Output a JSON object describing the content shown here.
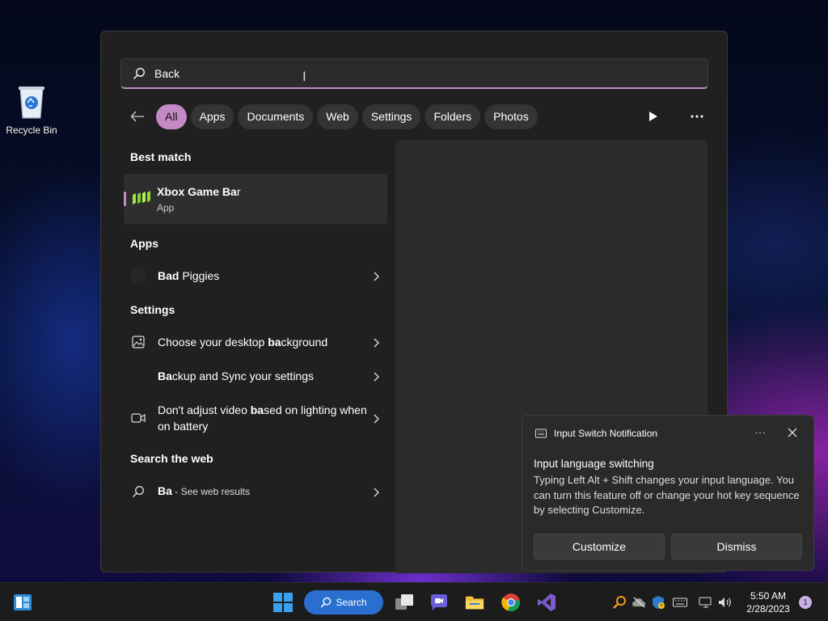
{
  "desktop": {
    "icons": [
      {
        "label": "Recycle Bin",
        "icon": "recycle-bin-icon"
      }
    ]
  },
  "search": {
    "value": "Back",
    "placeholder": "",
    "cursor_glyph": "I"
  },
  "filters": {
    "chips": [
      {
        "label": "All",
        "active": true
      },
      {
        "label": "Apps",
        "active": false
      },
      {
        "label": "Documents",
        "active": false
      },
      {
        "label": "Web",
        "active": false
      },
      {
        "label": "Settings",
        "active": false
      },
      {
        "label": "Folders",
        "active": false
      },
      {
        "label": "Photos",
        "active": false
      }
    ]
  },
  "results": {
    "best_match_label": "Best match",
    "best_match": {
      "name_bold": "Xbox Game Ba",
      "name_rest": "r",
      "sub": "App",
      "icon": "xbox-game-bar-icon"
    },
    "apps_label": "Apps",
    "apps": [
      {
        "bold": "Bad",
        "rest": " Piggies"
      }
    ],
    "settings_label": "Settings",
    "settings": [
      {
        "pre": "Choose your desktop ",
        "bold": "ba",
        "post": "ckground",
        "icon": "image-icon"
      },
      {
        "pre": "",
        "bold": "Ba",
        "post": "ckup and Sync your settings",
        "icon": ""
      },
      {
        "pre": "Don't adjust video ",
        "bold": "ba",
        "post": "sed on lighting when on battery",
        "icon": "video-camera-icon"
      }
    ],
    "web_label": "Search the web",
    "web": {
      "query": "Ba",
      "suffix": " - See web results"
    }
  },
  "notification": {
    "app_name": "Input Switch Notification",
    "more": "···",
    "title": "Input language switching",
    "body": "Typing Left Alt + Shift changes your input language. You can turn this feature off or change your hot key sequence by selecting Customize.",
    "customize": "Customize",
    "dismiss": "Dismiss"
  },
  "taskbar": {
    "search_label": "Search",
    "time": "5:50 AM",
    "date": "2/28/2023",
    "notification_count": "1"
  },
  "colors": {
    "accent": "#c38ac6",
    "taskbar_search": "#2a6fd0",
    "panel": "#202020"
  }
}
